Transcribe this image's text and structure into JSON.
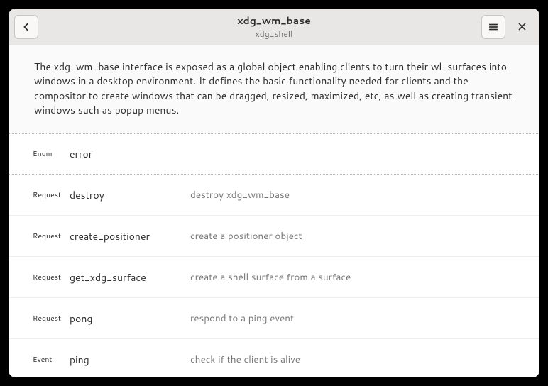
{
  "header": {
    "title": "xdg_wm_base",
    "subtitle": "xdg_shell"
  },
  "description": "The xdg_wm_base interface is exposed as a global object enabling clients to turn their wl_surfaces into windows in a desktop environment. It defines the basic functionality needed for clients and the compositor to create windows that can be dragged, resized, maximized, etc, as well as creating transient windows such as popup menus.",
  "rows": [
    {
      "kind": "Enum",
      "name": "error",
      "summary": ""
    },
    {
      "kind": "Request",
      "name": "destroy",
      "summary": "destroy xdg_wm_base"
    },
    {
      "kind": "Request",
      "name": "create_positioner",
      "summary": "create a positioner object"
    },
    {
      "kind": "Request",
      "name": "get_xdg_surface",
      "summary": "create a shell surface from a surface"
    },
    {
      "kind": "Request",
      "name": "pong",
      "summary": "respond to a ping event"
    },
    {
      "kind": "Event",
      "name": "ping",
      "summary": "check if the client is alive"
    }
  ],
  "selected_index": 0
}
